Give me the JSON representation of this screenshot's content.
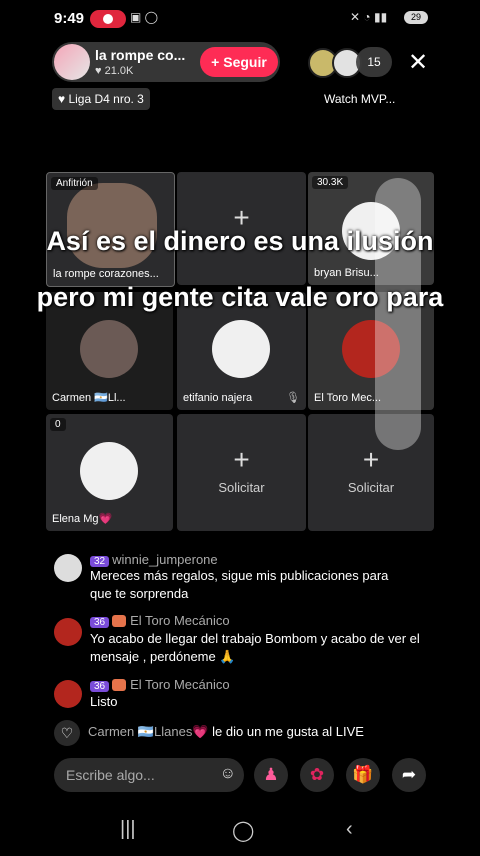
{
  "status_bar": {
    "time": "9:49",
    "battery": "29"
  },
  "host": {
    "name": "la rompe co...",
    "likes": "21.0K",
    "follow_label": "+ Seguir"
  },
  "viewers": {
    "count": "15"
  },
  "chips": {
    "league": "Liga D4 nro. 3",
    "watch": "Watch MVP..."
  },
  "grid": {
    "host_label": "Anfitrión",
    "host_name": "la rompe corazones...",
    "top_right_count": "30.3K",
    "request_label": "Solicitar",
    "guests": [
      {
        "name": "bryan Brisu..."
      },
      {
        "name": "Carmen 🇦🇷Ll..."
      },
      {
        "name": "etifanio najera"
      },
      {
        "name": "El Toro Mec..."
      },
      {
        "name": "Elena Mg💗",
        "count": "0"
      }
    ]
  },
  "caption": {
    "line1": "Así es el dinero es una ilusión",
    "line2": "pero mi gente cita vale oro para"
  },
  "chat": [
    {
      "level": "32",
      "name": "winnie_jumperone",
      "message": "Mereces más regalos, sigue mis publicaciones para que te sorprenda"
    },
    {
      "level": "36",
      "name": "El Toro Mecánico",
      "message": "Yo acabo de llegar del trabajo Bombom y acabo de ver el mensaje , perdóneme 🙏"
    },
    {
      "level": "36",
      "name": "El Toro Mecánico",
      "message": "Listo"
    }
  ],
  "like_notice": {
    "user": "Carmen 🇦🇷Llanes💗",
    "text": "le dio un me gusta al LIVE"
  },
  "input": {
    "placeholder": "Escribe algo..."
  },
  "icons": [
    "heart-icon",
    "emoji-icon",
    "guests-icon",
    "rose-icon",
    "gift-icon",
    "share-icon",
    "close-icon"
  ]
}
